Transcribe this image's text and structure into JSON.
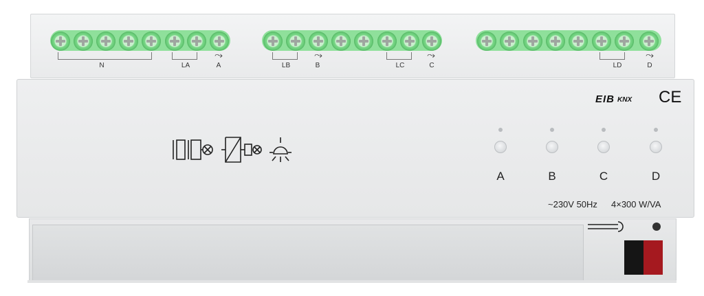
{
  "device": {
    "top_terminals": {
      "group1_labels": [
        "N",
        "LA",
        "A"
      ],
      "group2_labels": [
        "LB",
        "B",
        "LC",
        "C"
      ],
      "group3_labels": [
        "LD",
        "D"
      ]
    },
    "certifications": {
      "eib_label": "EIB",
      "knx_label": "KNX",
      "ce_label": "CE"
    },
    "channels": [
      "A",
      "B",
      "C",
      "D"
    ],
    "rating": {
      "voltage": "~230V 50Hz",
      "power": "4×300 W/VA"
    },
    "colors": {
      "terminal_green": "#7fd98c",
      "bus_red": "#a5191f",
      "bus_black": "#151515"
    },
    "icons": [
      "dimmer-function-icon",
      "trailing-edge-dimmer-icon",
      "lamp-icon",
      "knx-programming-loop-icon"
    ]
  }
}
